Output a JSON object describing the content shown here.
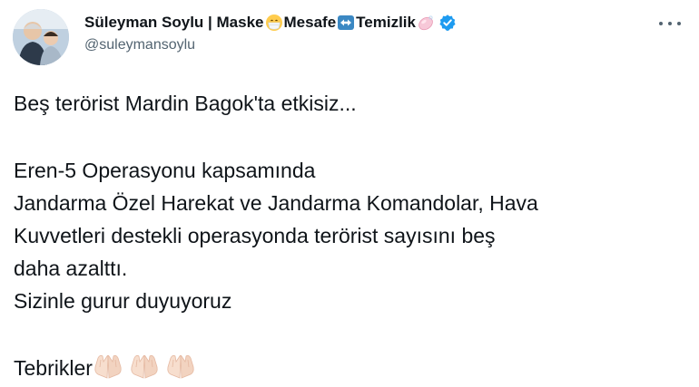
{
  "author": {
    "name_part1": "Süleyman Soylu | Maske",
    "name_part2": " Mesafe",
    "name_part3": " Temizlik",
    "handle": "@suleymansoylu",
    "verified": true
  },
  "icons": {
    "avatar": "profile-photo",
    "mask_emoji": "face-with-medical-mask-icon",
    "arrows_emoji": "left-right-arrow-icon",
    "soap_emoji": "soap-icon",
    "verified": "verified-badge-icon",
    "more": "more-options-icon",
    "clap": "folded-hands-icon"
  },
  "colors": {
    "text": "#0f1419",
    "secondary": "#536471",
    "verified": "#1d9bf0"
  },
  "tweet": {
    "line1": "Beş terörist Mardin Bagok'ta etkisiz...",
    "line2": "Eren-5 Operasyonu kapsamında",
    "line3": "Jandarma Özel Harekat ve Jandarma Komandolar, Hava",
    "line4": "Kuvvetleri destekli operasyonda terörist sayısını beş",
    "line5": "daha azalttı.",
    "line6": "Sizinle gurur duyuyoruz",
    "line7": "Tebrikler"
  }
}
